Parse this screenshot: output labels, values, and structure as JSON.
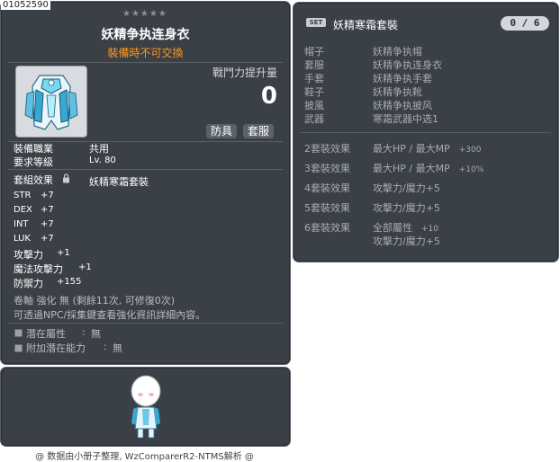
{
  "item_id": "01052590",
  "tooltip": {
    "stars": "★★★★★",
    "title": "妖精争执连身衣",
    "untradable": "裝備時不可交換",
    "power_label": "戰鬥力提升量",
    "power_value": "0",
    "tags": [
      "防具",
      "套服"
    ],
    "job_label": "裝備職業",
    "job_value": "共用",
    "level_label": "要求等級",
    "level_value": "Lv. 80",
    "set_label": "套組效果",
    "set_value": "妖精寒霜套裝",
    "stats": [
      {
        "name": "STR",
        "value": "+7"
      },
      {
        "name": "DEX",
        "value": "+7"
      },
      {
        "name": "INT",
        "value": "+7"
      },
      {
        "name": "LUK",
        "value": "+7"
      },
      {
        "name": "攻擊力",
        "value": "+1"
      },
      {
        "name": "魔法攻擊力",
        "value": "+1"
      },
      {
        "name": "防禦力",
        "value": "+155"
      }
    ],
    "scroll_text": "卷軸 強化 無 (剩餘11次, 可修復0次)",
    "enhance_text": "可透過NPC/採集鍵查看強化資訊詳細內容。",
    "potential_label": "潛在屬性",
    "potential_value": "無",
    "bonus_potential_label": "附加潛在能力",
    "bonus_potential_value": "無"
  },
  "set": {
    "icon_label": "SET",
    "name": "妖精寒霜套裝",
    "count": "0 / 6",
    "parts": [
      {
        "slot": "帽子",
        "name": "妖精争执帽"
      },
      {
        "slot": "套服",
        "name": "妖精争执连身衣"
      },
      {
        "slot": "手套",
        "name": "妖精争执手套"
      },
      {
        "slot": "鞋子",
        "name": "妖精争执靴"
      },
      {
        "slot": "披風",
        "name": "妖精争执披风"
      },
      {
        "slot": "武器",
        "name": "寒霜武器中选1"
      }
    ],
    "effects": [
      {
        "label": "2套裝效果",
        "lines": [
          {
            "text": "最大HP / 最大MP",
            "value": "+300"
          }
        ]
      },
      {
        "label": "3套裝效果",
        "lines": [
          {
            "text": "最大HP / 最大MP",
            "value": "+10%"
          }
        ]
      },
      {
        "label": "4套裝效果",
        "lines": [
          {
            "text": "攻擊力/魔力+5",
            "value": ""
          }
        ]
      },
      {
        "label": "5套裝效果",
        "lines": [
          {
            "text": "攻擊力/魔力+5",
            "value": ""
          }
        ]
      },
      {
        "label": "6套裝效果",
        "lines": [
          {
            "text": "全部屬性",
            "value": "+10"
          },
          {
            "text": "攻擊力/魔力+5",
            "value": ""
          }
        ]
      }
    ]
  },
  "footer": "@ 数据由小册子整理, WzComparerR2-NTMS解析 @",
  "icons": {
    "item": "armor-suit-icon",
    "lock": "lock-icon",
    "avatar": "character-avatar",
    "set": "set-icon"
  },
  "colors": {
    "panel": "#3b4047",
    "untradable": "#ff9a1f",
    "muted": "#a7abb1"
  }
}
